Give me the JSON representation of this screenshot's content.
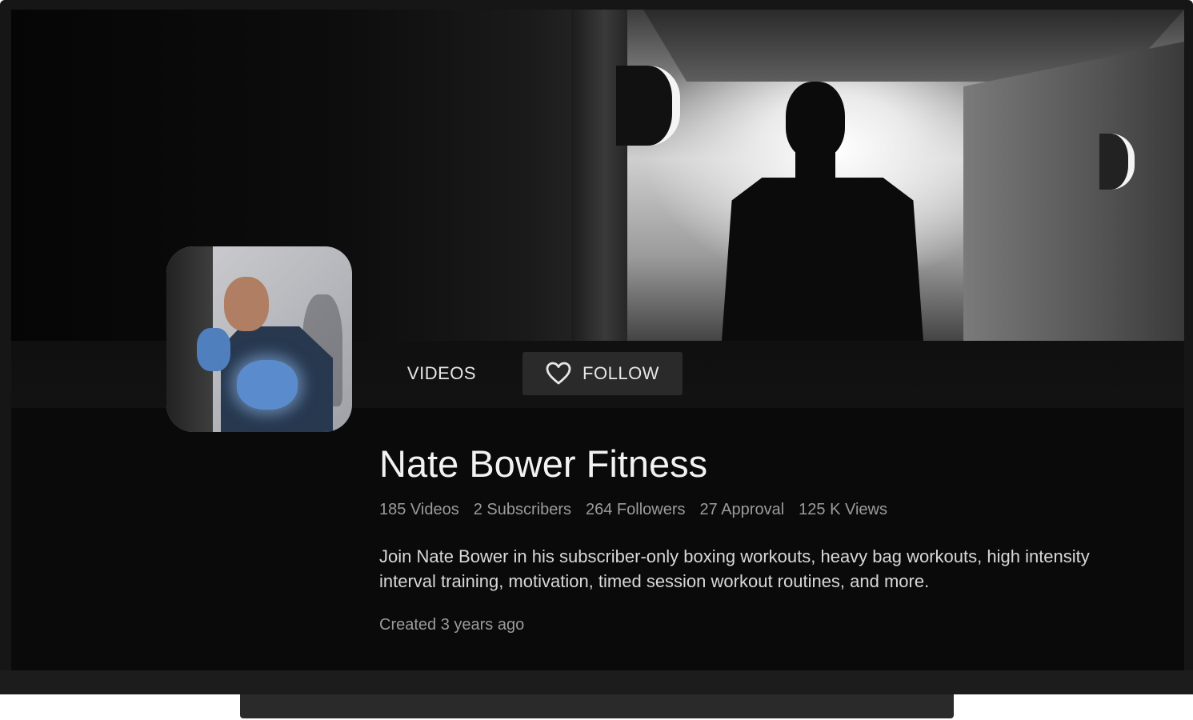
{
  "actions": {
    "videos_label": "VIDEOS",
    "follow_label": "FOLLOW"
  },
  "channel": {
    "title": "Nate Bower Fitness",
    "stats": [
      "185 Videos",
      "2 Subscribers",
      "264 Followers",
      "27 Approval",
      "125 K Views"
    ],
    "description": "Join Nate Bower in his subscriber-only boxing workouts, heavy bag workouts, high intensity interval training, motivation, timed session workout routines, and more.",
    "created": "Created 3 years ago"
  },
  "icons": {
    "follow_icon": "heart-outline-icon"
  },
  "colors": {
    "background": "#0a0a0a",
    "follow_button_bg": "#2a2a2a",
    "text_primary": "#f2f2f2",
    "text_secondary": "#9b9b9b"
  }
}
